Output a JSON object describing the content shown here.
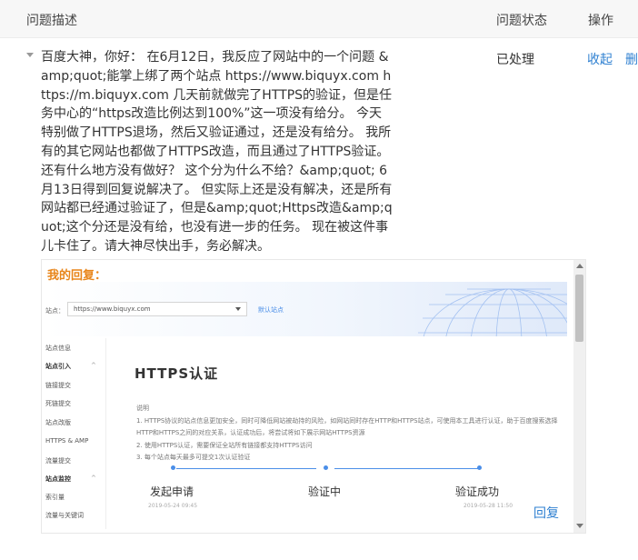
{
  "header": {
    "col_description": "问题描述",
    "col_status": "问题状态",
    "col_actions": "操作"
  },
  "row": {
    "description": "百度大神，你好： 在6月12日，我反应了网站中的一个问题 &amp;quot;能掌上绑了两个站点 https://www.biquyx.com https://m.biquyx.com 几天前就做完了HTTPS的验证，但是任务中心的“https改造比例达到100%”这一项没有给分。 今天特别做了HTTPS退场，然后又验证通过，还是没有给分。 我所有的其它网站也都做了HTTPS改造，而且通过了HTTPS验证。 还有什么地方没有做好？ 这个分为什么不给？&amp;quot; 6月13日得到回复说解决了。 但实际上还是没有解决，还是所有网站都已经通过验证了，但是&amp;quot;Https改造&amp;quot;这个分还是没有给，也没有进一步的任务。 现在被这件事儿卡住了。请大神尽快出手，务必解决。",
    "status": "已处理",
    "action_collapse": "收起",
    "action_delete": "删"
  },
  "reply": {
    "title": "我的回复：",
    "link": "回复"
  },
  "screenshot": {
    "site_label": "站点：",
    "site_value": "https://www.biquyx.com",
    "site_link": "默认站点",
    "sidebar": [
      {
        "label": "站点信息",
        "group": false,
        "chev": ""
      },
      {
        "label": "站点引入",
        "group": true,
        "chev": "^"
      },
      {
        "label": "链接提交",
        "group": false,
        "chev": ""
      },
      {
        "label": "死链提交",
        "group": false,
        "chev": ""
      },
      {
        "label": "站点改版",
        "group": false,
        "chev": ""
      },
      {
        "label": "HTTPS & AMP",
        "group": false,
        "chev": ""
      },
      {
        "label": "流量提交",
        "group": false,
        "chev": ""
      },
      {
        "label": "站点监控",
        "group": true,
        "chev": "^"
      },
      {
        "label": "索引量",
        "group": false,
        "chev": ""
      },
      {
        "label": "流量与关键词",
        "group": false,
        "chev": ""
      }
    ],
    "page_title": "HTTPS认证",
    "notes": [
      "说明",
      "1. HTTPS协议的站点信息更加安全，同时可降低网站被劫持的风险，如网站同时存在HTTP和HTTPS站点，可使用本工具进行认证，助于百度搜索选择",
      "HTTP和HTTPS之间的对应关系，认证成功后，将尝试将如下展示网站HTTPS资源",
      "2. 使用HTTPS认证，需要保证全站所有链接都支持HTTPS访问",
      "3. 每个站点每天最多可提交1次认证验证"
    ],
    "steps": [
      {
        "label": "发起申请",
        "date": "2019-05-24 09:45"
      },
      {
        "label": "验证中",
        "date": ""
      },
      {
        "label": "验证成功",
        "date": "2019-05-28 11:50"
      }
    ]
  },
  "colors": {
    "link": "#2f80d1",
    "reply_title": "#e8851a",
    "step_blue": "#4a8ee8"
  }
}
